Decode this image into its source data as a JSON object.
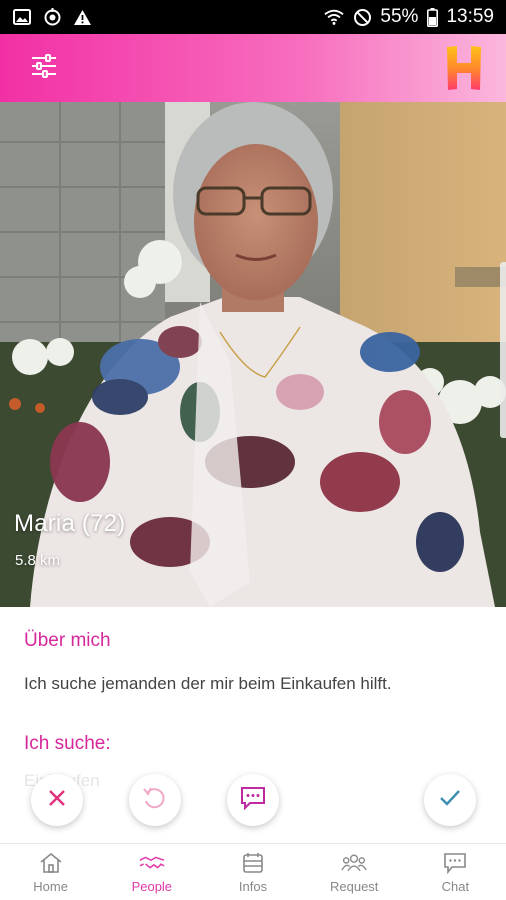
{
  "status_bar": {
    "battery": "55%",
    "time": "13:59",
    "icons_left": [
      "image-icon",
      "sync-icon",
      "warning-icon"
    ],
    "icons_right": [
      "wifi-icon",
      "do-not-disturb-icon",
      "battery-icon"
    ]
  },
  "header": {
    "filter_icon": "sliders-icon",
    "logo_letter": "H"
  },
  "profile": {
    "name": "Maria (72)",
    "distance": "5.8 km",
    "about_title": "Über mich",
    "about_text": "Ich suche jemanden der mir beim Einkaufen hilft.",
    "seeking_title": "Ich suche:",
    "seeking_text": "Einkaufen"
  },
  "actions": [
    {
      "name": "reject",
      "icon": "close-icon",
      "color": "#e0307a"
    },
    {
      "name": "undo",
      "icon": "undo-icon",
      "color": "#f0a9c7"
    },
    {
      "name": "message",
      "icon": "chat-icon",
      "color": "#c02aa0"
    },
    {
      "name": "accept",
      "icon": "check-icon",
      "color": "#3c8fb0"
    }
  ],
  "nav": [
    {
      "label": "Home",
      "icon": "home-icon",
      "active": false
    },
    {
      "label": "People",
      "icon": "handshake-icon",
      "active": true
    },
    {
      "label": "Infos",
      "icon": "info-board-icon",
      "active": false
    },
    {
      "label": "Request",
      "icon": "group-icon",
      "active": false
    },
    {
      "label": "Chat",
      "icon": "chat-bubble-icon",
      "active": false
    }
  ],
  "colors": {
    "brand_pink": "#f230a5",
    "accent_text": "#d6289a",
    "nav_active": "#e03aa8"
  }
}
